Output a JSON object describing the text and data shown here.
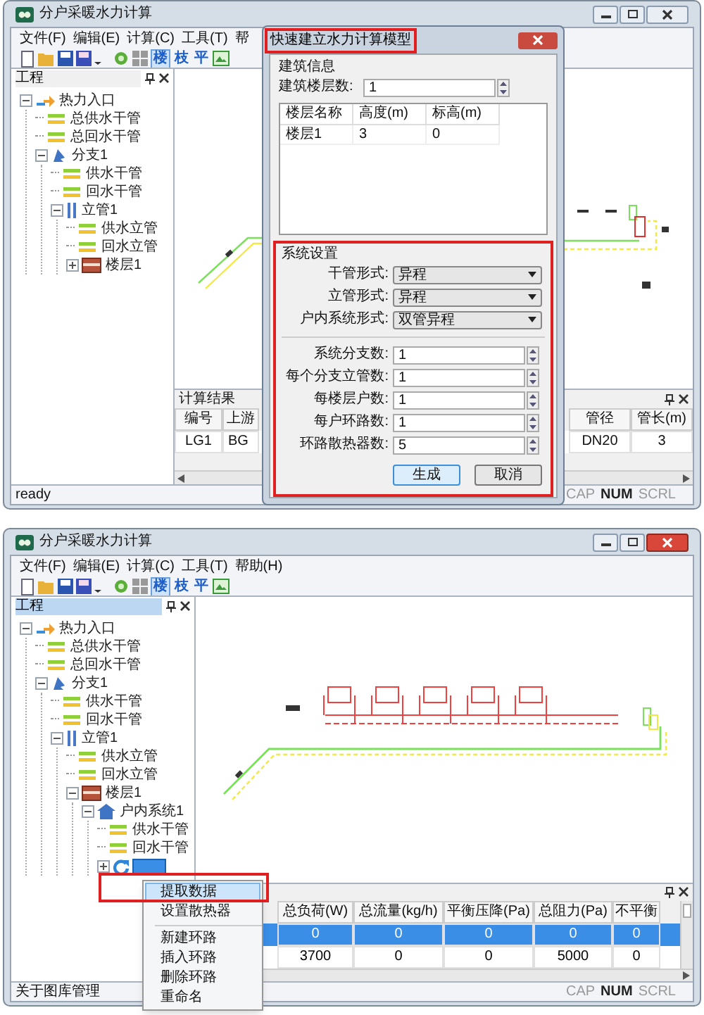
{
  "top_window": {
    "title": "分户采暖水力计算",
    "menu": [
      "文件(F)",
      "编辑(E)",
      "计算(C)",
      "工具(T)",
      "帮"
    ],
    "toolbar_glyphs": [
      "楼",
      "枝",
      "平"
    ],
    "tree_pane": {
      "title": "工程",
      "active": false
    },
    "tree": [
      {
        "label": "热力入口",
        "kind": "entry",
        "expanded": true,
        "selected": false,
        "children": [
          {
            "label": "总供水干管",
            "kind": "pipe",
            "selected": false
          },
          {
            "label": "总回水干管",
            "kind": "pipe",
            "selected": false
          },
          {
            "label": "分支1",
            "kind": "branch",
            "expanded": true,
            "selected": false,
            "children": [
              {
                "label": "供水干管",
                "kind": "pipe",
                "selected": false
              },
              {
                "label": "回水干管",
                "kind": "pipe",
                "selected": false
              },
              {
                "label": "立管1",
                "kind": "riser",
                "expanded": true,
                "selected": false,
                "children": [
                  {
                    "label": "供水立管",
                    "kind": "pipe",
                    "selected": false
                  },
                  {
                    "label": "回水立管",
                    "kind": "pipe",
                    "selected": false
                  },
                  {
                    "label": "楼层1",
                    "kind": "floor",
                    "expanded": false,
                    "selected": false
                  }
                ]
              }
            ]
          }
        ]
      }
    ],
    "results": {
      "title": "计算结果",
      "columns": [
        "编号",
        "上游",
        "管径",
        "管长(m)"
      ],
      "rows": [
        {
          "cells": [
            "LG1",
            "BG",
            "DN20",
            "3"
          ],
          "selected": false
        }
      ]
    },
    "status": "ready",
    "indicators": [
      {
        "label": "CAP",
        "on": false
      },
      {
        "label": "NUM",
        "on": true
      },
      {
        "label": "SCRL",
        "on": false
      }
    ],
    "dialog": {
      "title": "快速建立水力计算模型",
      "building": {
        "legend": "建筑信息",
        "floors_label": "建筑楼层数:",
        "floors_value": "1",
        "columns": [
          "楼层名称",
          "高度(m)",
          "标高(m)"
        ],
        "rows": [
          [
            "楼层1",
            "3",
            "0"
          ]
        ]
      },
      "system": {
        "legend": "系统设置",
        "selects": [
          {
            "label": "干管形式:",
            "value": "异程"
          },
          {
            "label": "立管形式:",
            "value": "异程"
          },
          {
            "label": "户内系统形式:",
            "value": "双管异程"
          }
        ],
        "spinners": [
          {
            "label": "系统分支数:",
            "value": "1"
          },
          {
            "label": "每个分支立管数:",
            "value": "1"
          },
          {
            "label": "每楼层户数:",
            "value": "1"
          },
          {
            "label": "每户环路数:",
            "value": "1"
          },
          {
            "label": "环路散热器数:",
            "value": "5"
          }
        ]
      },
      "buttons": [
        {
          "label": "生成",
          "default": true
        },
        {
          "label": "取消",
          "default": false
        }
      ]
    }
  },
  "bottom_window": {
    "title": "分户采暖水力计算",
    "menu": [
      "文件(F)",
      "编辑(E)",
      "计算(C)",
      "工具(T)",
      "帮助(H)"
    ],
    "toolbar_glyphs": [
      "楼",
      "枝",
      "平"
    ],
    "tree_pane": {
      "title": "工程",
      "active": true
    },
    "tree": [
      {
        "label": "热力入口",
        "kind": "entry",
        "expanded": true,
        "selected": false,
        "children": [
          {
            "label": "总供水干管",
            "kind": "pipe",
            "selected": false
          },
          {
            "label": "总回水干管",
            "kind": "pipe",
            "selected": false
          },
          {
            "label": "分支1",
            "kind": "branch",
            "expanded": true,
            "selected": false,
            "children": [
              {
                "label": "供水干管",
                "kind": "pipe",
                "selected": false
              },
              {
                "label": "回水干管",
                "kind": "pipe",
                "selected": false
              },
              {
                "label": "立管1",
                "kind": "riser",
                "expanded": true,
                "selected": false,
                "children": [
                  {
                    "label": "供水立管",
                    "kind": "pipe",
                    "selected": false
                  },
                  {
                    "label": "回水立管",
                    "kind": "pipe",
                    "selected": false
                  },
                  {
                    "label": "楼层1",
                    "kind": "floor",
                    "expanded": true,
                    "selected": false,
                    "children": [
                      {
                        "label": "户内系统1",
                        "kind": "house",
                        "expanded": true,
                        "selected": false,
                        "children": [
                          {
                            "label": "供水干管",
                            "kind": "pipe",
                            "selected": false
                          },
                          {
                            "label": "回水干管",
                            "kind": "pipe",
                            "selected": false
                          },
                          {
                            "kind": "loop",
                            "expanded": false,
                            "selected": true
                          }
                        ]
                      }
                    ]
                  }
                ]
              }
            ]
          }
        ]
      }
    ],
    "results": {
      "columns": [
        "总负荷(W)",
        "总流量(kg/h)",
        "平衡压降(Pa)",
        "总阻力(Pa)",
        "不平衡"
      ],
      "rows": [
        {
          "cells": [
            "0",
            "0",
            "0",
            "0",
            "0"
          ],
          "selected": true
        },
        {
          "cells": [
            "3700",
            "0",
            "0",
            "5000",
            "0"
          ],
          "selected": false
        }
      ]
    },
    "status": "关于图库管理",
    "indicators": [
      {
        "label": "CAP",
        "on": false
      },
      {
        "label": "NUM",
        "on": true
      },
      {
        "label": "SCRL",
        "on": false
      }
    ],
    "context_menu": [
      {
        "kind": "item",
        "label": "提取数据",
        "selected": true
      },
      {
        "kind": "item",
        "label": "设置散热器",
        "selected": false
      },
      {
        "kind": "separator"
      },
      {
        "kind": "item",
        "label": "新建环路",
        "selected": false
      },
      {
        "kind": "item",
        "label": "插入环路",
        "selected": false
      },
      {
        "kind": "item",
        "label": "删除环路",
        "selected": false
      },
      {
        "kind": "item",
        "label": "重命名",
        "selected": false
      }
    ]
  }
}
